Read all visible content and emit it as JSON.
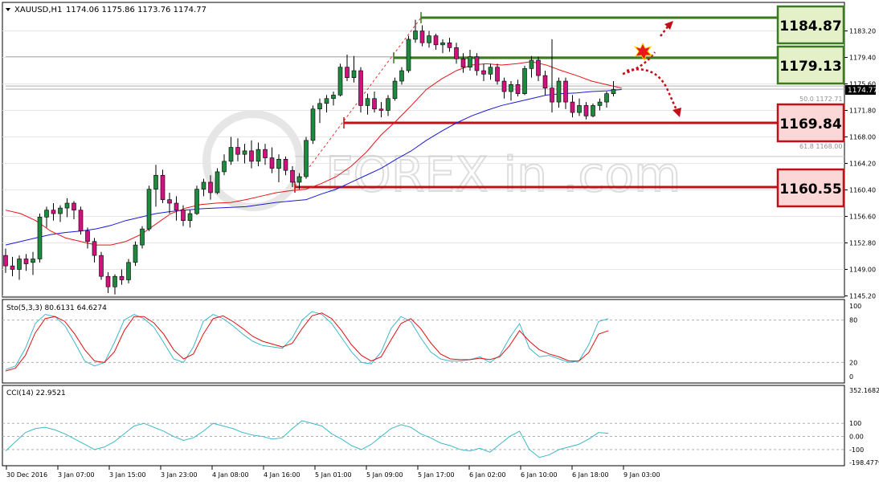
{
  "header": {
    "symbol": "XAUUSD,H1",
    "ohlc": "1174.06 1175.86 1173.76 1174.77"
  },
  "watermark": {
    "text": "FOREX in .com",
    "style": "circular logo mark beside the letters, stylized i and n glyphs"
  },
  "colors": {
    "bull": "#1f8a3f",
    "bear": "#d0127e",
    "ma_fast": "#e8151b",
    "ma_slow": "#1a1ad6",
    "stoch_main": "#3fb8c8",
    "stoch_signal": "#e01010",
    "cci": "#3fb8c8",
    "resistance": "#3b7a1e",
    "support": "#c0101a"
  },
  "levels": [
    {
      "id": "r2",
      "label": "1184.87",
      "kind": "resistance"
    },
    {
      "id": "r1",
      "label": "1179.13",
      "kind": "resistance"
    },
    {
      "id": "s1",
      "label": "1169.84",
      "kind": "support"
    },
    {
      "id": "s2",
      "label": "1160.55",
      "kind": "support"
    }
  ],
  "price_axis": {
    "ticks": [
      "1183.20",
      "1179.40",
      "1175.60",
      "1171.80",
      "1168.00",
      "1164.20",
      "1160.40",
      "1156.60",
      "1152.80",
      "1149.00",
      "1145.20"
    ],
    "current_label": "1174.77"
  },
  "fibo": {
    "label_50": "50.0 1172.71",
    "label_61": "61.8 1168.00"
  },
  "time_axis": [
    "30 Dec 2016",
    "3 Jan 07:00",
    "3 Jan 15:00",
    "3 Jan 23:00",
    "4 Jan 08:00",
    "4 Jan 16:00",
    "5 Jan 01:00",
    "5 Jan 09:00",
    "5 Jan 17:00",
    "6 Jan 02:00",
    "6 Jan 10:00",
    "6 Jan 18:00",
    "9 Jan 03:00"
  ],
  "stoch": {
    "label": "Sto(5,3,3) 80.6131 64.6274",
    "axis_labels": [
      "100",
      "80",
      "20",
      "0"
    ]
  },
  "cci": {
    "label": "CCI(14) 22.9521",
    "axis_labels": [
      "352.1682",
      "100",
      "0.00",
      "-100",
      "-198.4779"
    ]
  },
  "chart_data": {
    "type": "candlestick",
    "symbol": "XAUUSD",
    "timeframe": "H1",
    "ylim": [
      1145.2,
      1186.5
    ],
    "levels": [
      1184.87,
      1179.13,
      1169.84,
      1160.55
    ],
    "candles": [
      [
        1151.0,
        1152.0,
        1148.5,
        1149.5
      ],
      [
        1149.5,
        1150.8,
        1148.0,
        1149.0
      ],
      [
        1149.0,
        1151.0,
        1147.5,
        1150.5
      ],
      [
        1150.5,
        1151.2,
        1148.8,
        1149.8
      ],
      [
        1150.0,
        1151.5,
        1148.2,
        1150.5
      ],
      [
        1150.5,
        1157.0,
        1150.0,
        1156.5
      ],
      [
        1156.5,
        1158.0,
        1155.0,
        1157.5
      ],
      [
        1157.5,
        1158.5,
        1156.0,
        1157.0
      ],
      [
        1157.0,
        1158.2,
        1155.8,
        1157.8
      ],
      [
        1157.8,
        1159.2,
        1156.5,
        1158.5
      ],
      [
        1158.5,
        1158.8,
        1156.2,
        1157.5
      ],
      [
        1157.5,
        1158.0,
        1154.0,
        1154.5
      ],
      [
        1154.5,
        1155.0,
        1152.0,
        1153.0
      ],
      [
        1153.0,
        1153.5,
        1150.0,
        1151.0
      ],
      [
        1151.0,
        1151.5,
        1147.5,
        1148.0
      ],
      [
        1148.0,
        1148.6,
        1145.6,
        1146.5
      ],
      [
        1146.5,
        1148.3,
        1145.4,
        1148.0
      ],
      [
        1148.0,
        1149.0,
        1146.8,
        1147.5
      ],
      [
        1147.5,
        1150.5,
        1147.0,
        1150.0
      ],
      [
        1150.0,
        1153.0,
        1149.5,
        1152.5
      ],
      [
        1152.5,
        1155.2,
        1152.0,
        1154.8
      ],
      [
        1154.8,
        1161.0,
        1154.5,
        1160.5
      ],
      [
        1160.5,
        1164.0,
        1158.0,
        1162.5
      ],
      [
        1162.5,
        1163.3,
        1158.5,
        1159.0
      ],
      [
        1159.0,
        1160.0,
        1157.0,
        1158.5
      ],
      [
        1158.5,
        1159.5,
        1156.0,
        1157.5
      ],
      [
        1157.5,
        1158.2,
        1155.2,
        1156.0
      ],
      [
        1156.0,
        1157.5,
        1155.0,
        1157.0
      ],
      [
        1157.0,
        1161.0,
        1156.8,
        1160.5
      ],
      [
        1160.5,
        1162.0,
        1159.5,
        1161.5
      ],
      [
        1161.5,
        1162.5,
        1159.0,
        1160.0
      ],
      [
        1160.0,
        1163.5,
        1159.8,
        1163.0
      ],
      [
        1163.0,
        1165.5,
        1162.5,
        1164.5
      ],
      [
        1164.5,
        1168.0,
        1164.0,
        1166.5
      ],
      [
        1166.5,
        1167.8,
        1164.5,
        1165.5
      ],
      [
        1165.5,
        1167.0,
        1164.2,
        1166.0
      ],
      [
        1166.0,
        1167.5,
        1163.5,
        1164.5
      ],
      [
        1164.5,
        1167.2,
        1163.8,
        1166.2
      ],
      [
        1166.2,
        1167.0,
        1164.0,
        1165.0
      ],
      [
        1165.0,
        1166.5,
        1162.8,
        1163.5
      ],
      [
        1163.5,
        1165.5,
        1161.5,
        1164.8
      ],
      [
        1164.8,
        1165.2,
        1162.5,
        1163.2
      ],
      [
        1163.2,
        1163.8,
        1160.8,
        1161.5
      ],
      [
        1161.5,
        1162.8,
        1160.5,
        1162.3
      ],
      [
        1162.3,
        1168.0,
        1162.0,
        1167.5
      ],
      [
        1167.5,
        1172.5,
        1167.0,
        1172.0
      ],
      [
        1172.0,
        1173.5,
        1170.0,
        1172.8
      ],
      [
        1172.8,
        1174.0,
        1171.5,
        1173.5
      ],
      [
        1173.5,
        1174.5,
        1172.5,
        1174.0
      ],
      [
        1174.0,
        1178.5,
        1173.8,
        1178.0
      ],
      [
        1178.0,
        1179.8,
        1176.0,
        1176.5
      ],
      [
        1176.5,
        1179.6,
        1175.8,
        1177.5
      ],
      [
        1177.5,
        1178.0,
        1171.5,
        1172.5
      ],
      [
        1172.5,
        1174.2,
        1171.2,
        1173.5
      ],
      [
        1173.5,
        1174.5,
        1171.5,
        1172.0
      ],
      [
        1172.0,
        1173.0,
        1170.8,
        1171.8
      ],
      [
        1171.8,
        1174.0,
        1171.0,
        1173.5
      ],
      [
        1173.5,
        1176.5,
        1173.2,
        1176.0
      ],
      [
        1176.0,
        1178.0,
        1175.5,
        1177.5
      ],
      [
        1177.5,
        1182.5,
        1177.2,
        1182.0
      ],
      [
        1182.0,
        1184.8,
        1181.5,
        1183.2
      ],
      [
        1183.2,
        1184.0,
        1181.0,
        1181.5
      ],
      [
        1181.5,
        1183.2,
        1180.8,
        1182.5
      ],
      [
        1182.5,
        1182.8,
        1180.5,
        1181.2
      ],
      [
        1181.2,
        1182.0,
        1180.0,
        1181.5
      ],
      [
        1181.5,
        1182.2,
        1180.2,
        1180.8
      ],
      [
        1180.8,
        1181.5,
        1178.5,
        1179.2
      ],
      [
        1179.2,
        1180.0,
        1177.2,
        1178.0
      ],
      [
        1178.0,
        1180.5,
        1177.5,
        1179.5
      ],
      [
        1179.5,
        1180.0,
        1176.8,
        1177.5
      ],
      [
        1177.5,
        1178.5,
        1176.0,
        1177.0
      ],
      [
        1177.0,
        1178.5,
        1176.2,
        1178.0
      ],
      [
        1178.0,
        1178.5,
        1175.5,
        1176.0
      ],
      [
        1176.0,
        1176.5,
        1173.5,
        1174.5
      ],
      [
        1174.5,
        1176.0,
        1173.2,
        1175.5
      ],
      [
        1175.5,
        1176.2,
        1173.8,
        1174.2
      ],
      [
        1174.2,
        1178.2,
        1174.0,
        1177.8
      ],
      [
        1177.8,
        1179.6,
        1176.5,
        1179.0
      ],
      [
        1179.0,
        1179.5,
        1176.0,
        1176.8
      ],
      [
        1176.8,
        1177.5,
        1174.0,
        1175.0
      ],
      [
        1175.0,
        1182.0,
        1171.5,
        1173.0
      ],
      [
        1173.0,
        1176.5,
        1172.2,
        1176.0
      ],
      [
        1176.0,
        1176.5,
        1172.0,
        1173.0
      ],
      [
        1173.0,
        1174.0,
        1170.8,
        1171.5
      ],
      [
        1171.5,
        1173.5,
        1171.0,
        1172.5
      ],
      [
        1172.5,
        1173.0,
        1170.5,
        1171.0
      ],
      [
        1171.0,
        1172.8,
        1170.8,
        1172.5
      ],
      [
        1172.5,
        1173.5,
        1171.8,
        1173.0
      ],
      [
        1173.0,
        1174.5,
        1172.2,
        1174.2
      ],
      [
        1174.2,
        1176.0,
        1173.8,
        1174.8
      ]
    ],
    "ma_fast": [
      1157.5,
      1157.0,
      1156.0,
      1154.5,
      1153.5,
      1153.0,
      1152.5,
      1152.5,
      1153.0,
      1154.0,
      1155.5,
      1157.0,
      1157.8,
      1158.3,
      1158.5,
      1158.6,
      1159.0,
      1159.5,
      1160.0,
      1160.3,
      1160.5,
      1161.3,
      1162.3,
      1163.8,
      1165.8,
      1168.3,
      1170.3,
      1172.5,
      1174.8,
      1176.3,
      1177.5,
      1178.3,
      1178.5,
      1178.3,
      1178.5,
      1178.8,
      1178.3,
      1177.5,
      1176.8,
      1176.0,
      1175.5,
      1175.0
    ],
    "ma_slow": [
      1152.5,
      1153.0,
      1153.5,
      1154.0,
      1154.3,
      1154.5,
      1154.8,
      1155.3,
      1156.0,
      1156.5,
      1157.0,
      1157.3,
      1157.5,
      1157.7,
      1157.8,
      1157.9,
      1158.0,
      1158.3,
      1158.6,
      1158.8,
      1159.0,
      1159.8,
      1160.5,
      1161.5,
      1162.5,
      1163.5,
      1164.8,
      1166.0,
      1167.5,
      1168.8,
      1170.0,
      1171.0,
      1171.8,
      1172.5,
      1173.0,
      1173.5,
      1174.0,
      1174.2,
      1174.3,
      1174.5,
      1174.6,
      1174.8
    ],
    "stoch_main": [
      10,
      15,
      40,
      75,
      88,
      85,
      72,
      48,
      22,
      15,
      20,
      48,
      80,
      88,
      82,
      70,
      48,
      25,
      20,
      42,
      78,
      88,
      82,
      72,
      60,
      50,
      44,
      42,
      40,
      55,
      80,
      92,
      88,
      75,
      55,
      35,
      20,
      18,
      35,
      68,
      85,
      78,
      55,
      35,
      25,
      22,
      22,
      24,
      28,
      20,
      30,
      55,
      75,
      40,
      28,
      30,
      25,
      20,
      22,
      45,
      78,
      82
    ],
    "stoch_signal": [
      8,
      12,
      30,
      62,
      82,
      85,
      78,
      60,
      38,
      22,
      20,
      35,
      65,
      85,
      85,
      76,
      60,
      38,
      25,
      32,
      60,
      82,
      86,
      78,
      68,
      57,
      50,
      46,
      42,
      47,
      68,
      86,
      90,
      82,
      65,
      45,
      30,
      22,
      28,
      52,
      75,
      82,
      68,
      48,
      32,
      25,
      24,
      24,
      26,
      24,
      28,
      44,
      65,
      50,
      38,
      32,
      28,
      22,
      22,
      34,
      60,
      65
    ],
    "cci": [
      -110,
      -40,
      30,
      60,
      70,
      50,
      20,
      -20,
      -60,
      -100,
      -80,
      -40,
      20,
      80,
      100,
      70,
      40,
      0,
      -30,
      -10,
      40,
      100,
      80,
      60,
      30,
      10,
      0,
      -20,
      -10,
      60,
      120,
      100,
      80,
      20,
      -20,
      -70,
      -100,
      -60,
      0,
      60,
      90,
      70,
      20,
      -10,
      -50,
      -70,
      -100,
      -110,
      -90,
      -120,
      -60,
      0,
      40,
      -100,
      -160,
      -140,
      -100,
      -80,
      -60,
      -20,
      30,
      23
    ]
  }
}
